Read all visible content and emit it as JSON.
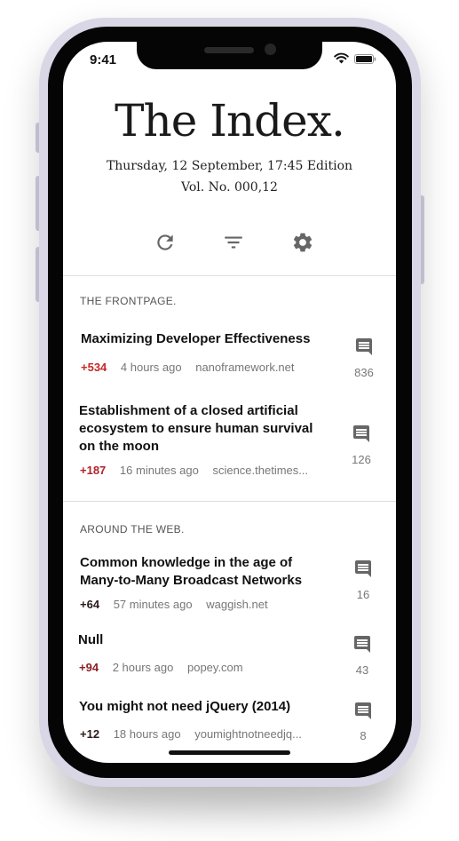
{
  "status": {
    "time": "9:41"
  },
  "masthead": {
    "title": "The Index.",
    "edition": "Thursday, 12 September, 17:45 Edition",
    "volume": "Vol. No. 000,12"
  },
  "toolbar": {
    "icons": [
      "refresh-icon",
      "filter-icon",
      "settings-icon"
    ]
  },
  "sections": [
    {
      "label": "THE FRONTPAGE.",
      "stories": [
        {
          "title": "Maximizing Developer Effectiveness",
          "score": "+534",
          "age": "4 hours ago",
          "domain": "nanoframework.net",
          "comments": "836"
        },
        {
          "title": "Establishment of a closed artificial ecosystem to ensure human survival on the moon",
          "score": "+187",
          "age": "16 minutes ago",
          "domain": "science.thetimes...",
          "comments": "126"
        }
      ]
    },
    {
      "label": "AROUND THE WEB.",
      "stories": [
        {
          "title": "Common knowledge in the age of Many-to-Many Broadcast Networks",
          "score": "+64",
          "age": "57 minutes ago",
          "domain": "waggish.net",
          "comments": "16"
        },
        {
          "title": "Null",
          "score": "+94",
          "age": "2 hours ago",
          "domain": "popey.com",
          "comments": "43"
        },
        {
          "title": "You might not need jQuery (2014)",
          "score": "+12",
          "age": "18 hours ago",
          "domain": "youmightnotneedjq...",
          "comments": "8"
        }
      ]
    }
  ],
  "colors": {
    "score_red": "#c62828",
    "icon_gray": "#666666",
    "text_dark": "#111111"
  }
}
